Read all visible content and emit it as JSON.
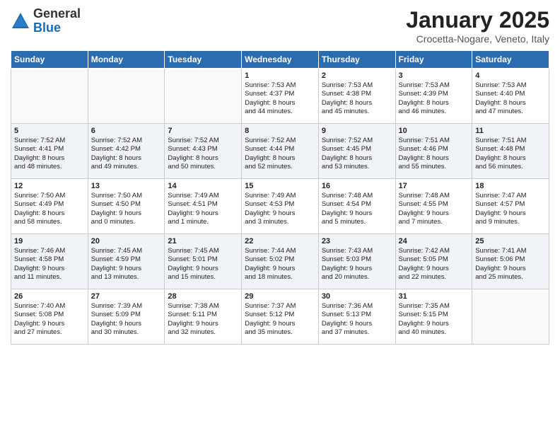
{
  "logo": {
    "general": "General",
    "blue": "Blue"
  },
  "title": "January 2025",
  "subtitle": "Crocetta-Nogare, Veneto, Italy",
  "weekdays": [
    "Sunday",
    "Monday",
    "Tuesday",
    "Wednesday",
    "Thursday",
    "Friday",
    "Saturday"
  ],
  "weeks": [
    [
      {
        "day": "",
        "text": ""
      },
      {
        "day": "",
        "text": ""
      },
      {
        "day": "",
        "text": ""
      },
      {
        "day": "1",
        "text": "Sunrise: 7:53 AM\nSunset: 4:37 PM\nDaylight: 8 hours\nand 44 minutes."
      },
      {
        "day": "2",
        "text": "Sunrise: 7:53 AM\nSunset: 4:38 PM\nDaylight: 8 hours\nand 45 minutes."
      },
      {
        "day": "3",
        "text": "Sunrise: 7:53 AM\nSunset: 4:39 PM\nDaylight: 8 hours\nand 46 minutes."
      },
      {
        "day": "4",
        "text": "Sunrise: 7:53 AM\nSunset: 4:40 PM\nDaylight: 8 hours\nand 47 minutes."
      }
    ],
    [
      {
        "day": "5",
        "text": "Sunrise: 7:52 AM\nSunset: 4:41 PM\nDaylight: 8 hours\nand 48 minutes."
      },
      {
        "day": "6",
        "text": "Sunrise: 7:52 AM\nSunset: 4:42 PM\nDaylight: 8 hours\nand 49 minutes."
      },
      {
        "day": "7",
        "text": "Sunrise: 7:52 AM\nSunset: 4:43 PM\nDaylight: 8 hours\nand 50 minutes."
      },
      {
        "day": "8",
        "text": "Sunrise: 7:52 AM\nSunset: 4:44 PM\nDaylight: 8 hours\nand 52 minutes."
      },
      {
        "day": "9",
        "text": "Sunrise: 7:52 AM\nSunset: 4:45 PM\nDaylight: 8 hours\nand 53 minutes."
      },
      {
        "day": "10",
        "text": "Sunrise: 7:51 AM\nSunset: 4:46 PM\nDaylight: 8 hours\nand 55 minutes."
      },
      {
        "day": "11",
        "text": "Sunrise: 7:51 AM\nSunset: 4:48 PM\nDaylight: 8 hours\nand 56 minutes."
      }
    ],
    [
      {
        "day": "12",
        "text": "Sunrise: 7:50 AM\nSunset: 4:49 PM\nDaylight: 8 hours\nand 58 minutes."
      },
      {
        "day": "13",
        "text": "Sunrise: 7:50 AM\nSunset: 4:50 PM\nDaylight: 9 hours\nand 0 minutes."
      },
      {
        "day": "14",
        "text": "Sunrise: 7:49 AM\nSunset: 4:51 PM\nDaylight: 9 hours\nand 1 minute."
      },
      {
        "day": "15",
        "text": "Sunrise: 7:49 AM\nSunset: 4:53 PM\nDaylight: 9 hours\nand 3 minutes."
      },
      {
        "day": "16",
        "text": "Sunrise: 7:48 AM\nSunset: 4:54 PM\nDaylight: 9 hours\nand 5 minutes."
      },
      {
        "day": "17",
        "text": "Sunrise: 7:48 AM\nSunset: 4:55 PM\nDaylight: 9 hours\nand 7 minutes."
      },
      {
        "day": "18",
        "text": "Sunrise: 7:47 AM\nSunset: 4:57 PM\nDaylight: 9 hours\nand 9 minutes."
      }
    ],
    [
      {
        "day": "19",
        "text": "Sunrise: 7:46 AM\nSunset: 4:58 PM\nDaylight: 9 hours\nand 11 minutes."
      },
      {
        "day": "20",
        "text": "Sunrise: 7:45 AM\nSunset: 4:59 PM\nDaylight: 9 hours\nand 13 minutes."
      },
      {
        "day": "21",
        "text": "Sunrise: 7:45 AM\nSunset: 5:01 PM\nDaylight: 9 hours\nand 15 minutes."
      },
      {
        "day": "22",
        "text": "Sunrise: 7:44 AM\nSunset: 5:02 PM\nDaylight: 9 hours\nand 18 minutes."
      },
      {
        "day": "23",
        "text": "Sunrise: 7:43 AM\nSunset: 5:03 PM\nDaylight: 9 hours\nand 20 minutes."
      },
      {
        "day": "24",
        "text": "Sunrise: 7:42 AM\nSunset: 5:05 PM\nDaylight: 9 hours\nand 22 minutes."
      },
      {
        "day": "25",
        "text": "Sunrise: 7:41 AM\nSunset: 5:06 PM\nDaylight: 9 hours\nand 25 minutes."
      }
    ],
    [
      {
        "day": "26",
        "text": "Sunrise: 7:40 AM\nSunset: 5:08 PM\nDaylight: 9 hours\nand 27 minutes."
      },
      {
        "day": "27",
        "text": "Sunrise: 7:39 AM\nSunset: 5:09 PM\nDaylight: 9 hours\nand 30 minutes."
      },
      {
        "day": "28",
        "text": "Sunrise: 7:38 AM\nSunset: 5:11 PM\nDaylight: 9 hours\nand 32 minutes."
      },
      {
        "day": "29",
        "text": "Sunrise: 7:37 AM\nSunset: 5:12 PM\nDaylight: 9 hours\nand 35 minutes."
      },
      {
        "day": "30",
        "text": "Sunrise: 7:36 AM\nSunset: 5:13 PM\nDaylight: 9 hours\nand 37 minutes."
      },
      {
        "day": "31",
        "text": "Sunrise: 7:35 AM\nSunset: 5:15 PM\nDaylight: 9 hours\nand 40 minutes."
      },
      {
        "day": "",
        "text": ""
      }
    ]
  ]
}
